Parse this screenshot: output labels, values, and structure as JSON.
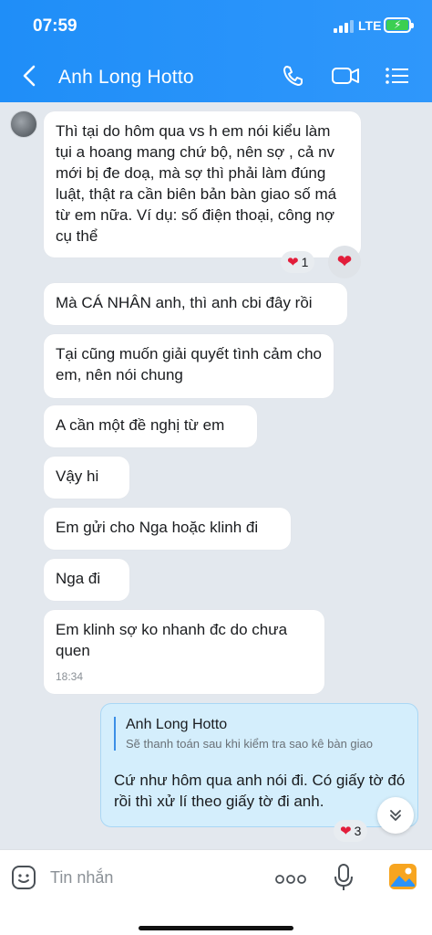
{
  "status_bar": {
    "time": "07:59",
    "network": "LTE"
  },
  "header": {
    "title": "Anh Long Hotto",
    "icons": [
      "back-icon",
      "phone-icon",
      "video-call-icon",
      "menu-list-icon"
    ]
  },
  "messages": [
    {
      "text": "Thì tại do hôm qua vs h em nói kiểu làm tụi a hoang mang chứ bộ, nên sợ , cả nv mới bị đe doạ, mà sợ thì phải làm đúng luật, thật ra cần biên bản bàn giao số má từ em nữa. Ví dụ: số điện thoại, công nợ cụ thể",
      "reaction_count": "1"
    },
    {
      "text": "Mà CÁ NHÂN anh, thì anh cbi đây rồi"
    },
    {
      "text": "Tại cũng muốn giải quyết tình cảm cho em, nên nói chung"
    },
    {
      "text": "A cần một đề nghị từ em"
    },
    {
      "text": "Vậy hi"
    },
    {
      "text": "Em gửi cho Nga hoặc klinh đi"
    },
    {
      "text": "Nga đi"
    },
    {
      "text": "Em klinh sợ ko nhanh đc do chưa quen",
      "time": "18:34"
    }
  ],
  "sent_message": {
    "quote_name": "Anh Long Hotto",
    "quote_text": "Sẽ thanh toán sau khi kiểm tra sao kê bàn giao",
    "text": "Cứ như hôm qua anh nói đi. Có giấy tờ đó rồi thì xử lí theo giấy tờ đi anh.",
    "reaction_count": "3"
  },
  "composer": {
    "placeholder": "Tin nhắn",
    "icons": [
      "sticker-icon",
      "more-icon",
      "microphone-icon",
      "image-icon"
    ]
  },
  "colors": {
    "header_blue": "#2a93fa",
    "heart_red": "#e21d3a",
    "sent_bubble": "#d4eefc"
  }
}
